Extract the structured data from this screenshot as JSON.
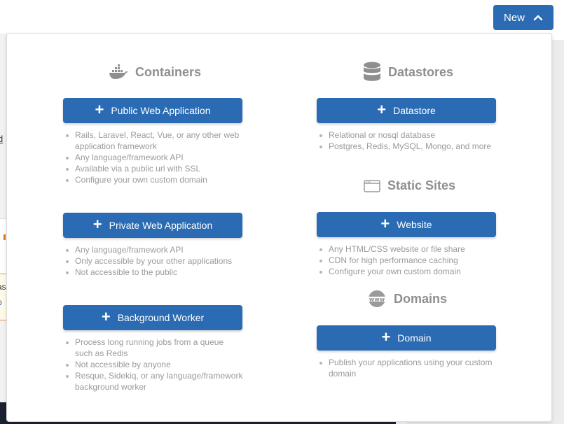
{
  "header": {
    "new_button_label": "New"
  },
  "background": {
    "fragment_link": "d",
    "alert_line1": "as",
    "alert_line2": "b"
  },
  "sections": {
    "containers": {
      "title": "Containers",
      "icon": "docker-whale-icon",
      "items": [
        {
          "button_label": "Public Web Application",
          "features": [
            "Rails, Laravel, React, Vue, or any other web application framework",
            "Any language/framework API",
            "Available via a public url with SSL",
            "Configure your own custom domain"
          ]
        },
        {
          "button_label": "Private Web Application",
          "features": [
            "Any language/framework API",
            "Only accessible by your other applications",
            "Not accessible to the public"
          ]
        },
        {
          "button_label": "Background Worker",
          "features": [
            "Process long running jobs from a queue such as Redis",
            "Not accessible by anyone",
            "Resque, Sidekiq, or any language/framework background worker"
          ]
        }
      ]
    },
    "datastores": {
      "title": "Datastores",
      "icon": "database-icon",
      "button_label": "Datastore",
      "features": [
        "Relational or nosql database",
        "Postgres, Redis, MySQL, Mongo, and more"
      ]
    },
    "static_sites": {
      "title": "Static Sites",
      "icon": "browser-window-icon",
      "button_label": "Website",
      "features": [
        "Any HTML/CSS website or file share",
        "CDN for high performance caching",
        "Configure your own custom domain"
      ]
    },
    "domains": {
      "title": "Domains",
      "icon": "www-globe-icon",
      "button_label": "Domain",
      "features": [
        "Publish your applications using your custom domain"
      ]
    }
  },
  "colors": {
    "primary": "#2a6bb3",
    "heading": "#8f8f8f",
    "feature_text": "#9a9a9a"
  }
}
